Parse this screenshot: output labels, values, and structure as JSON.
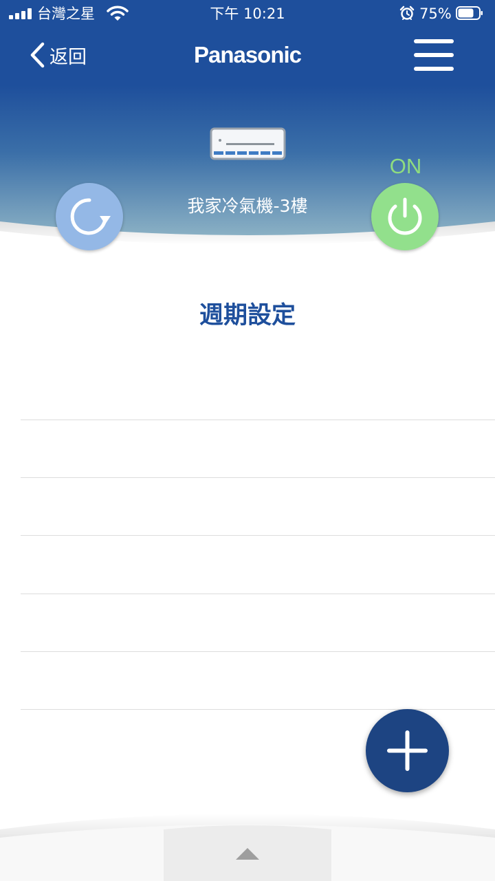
{
  "status_bar": {
    "carrier": "台灣之星",
    "time": "下午 10:21",
    "battery_percent": "75%",
    "battery_level": 0.75,
    "icons": [
      "signal-icon",
      "wifi-icon",
      "alarm-icon",
      "battery-icon"
    ]
  },
  "nav": {
    "back_label": "返回",
    "brand": "Panasonic",
    "menu_icon": "hamburger-menu-icon"
  },
  "device": {
    "name": "我家冷氣機-3樓",
    "power_state": "ON",
    "icon": "air-conditioner-icon",
    "mode_icon": "refresh-icon",
    "power_icon": "power-icon"
  },
  "schedule": {
    "title": "週期設定",
    "rows": [
      "",
      "",
      "",
      "",
      "",
      ""
    ],
    "add_icon": "plus-icon"
  },
  "drawer": {
    "handle_icon": "caret-up-icon"
  },
  "colors": {
    "header_blue": "#1e4f9c",
    "hero_teal": "#7fa6bf",
    "power_green": "#92e08c",
    "mode_blue": "#94b8e6",
    "fab_navy": "#1d4482",
    "title_blue": "#1e4f9c"
  }
}
